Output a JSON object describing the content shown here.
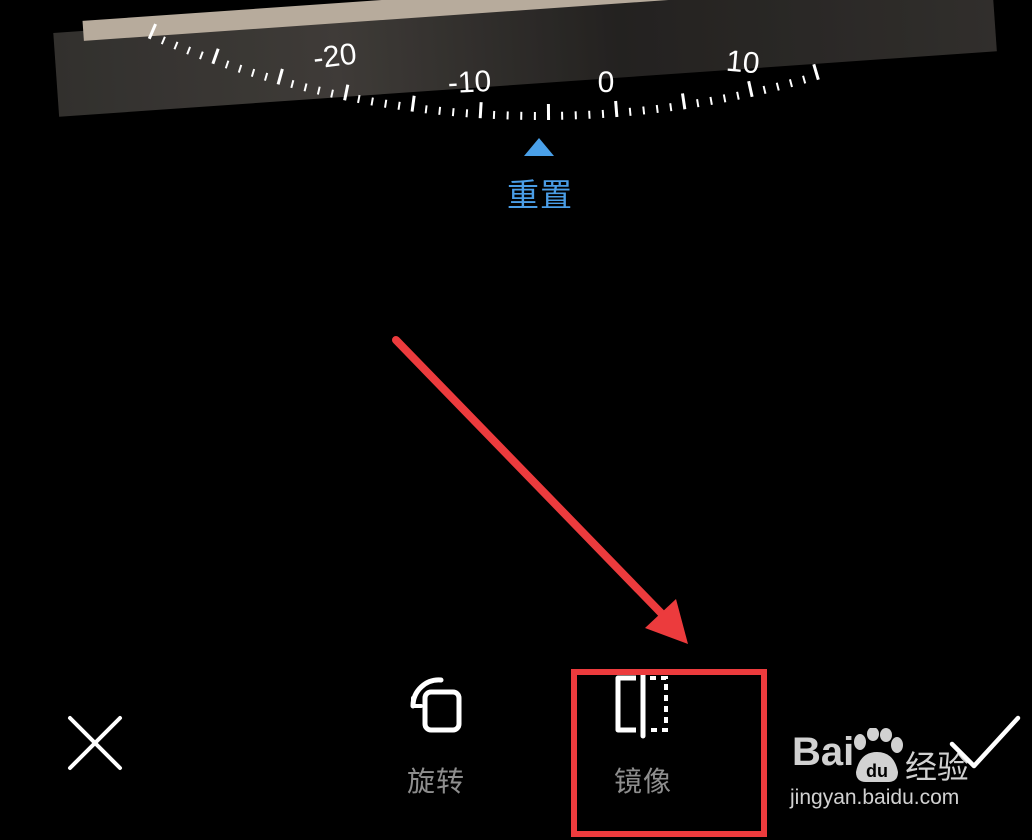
{
  "dial": {
    "tick_labels": [
      "-20",
      "-10",
      "0",
      "10"
    ],
    "value": 0
  },
  "reset": {
    "label": "重置"
  },
  "tools": {
    "rotate_label": "旋转",
    "mirror_label": "镜像"
  },
  "watermark": {
    "logo": "Bai",
    "logo_sub": "du",
    "brand": "经验",
    "url": "jingyan.baidu.com"
  },
  "colors": {
    "accent": "#4a9de6",
    "annotation": "#ec3b3d",
    "tool_label": "#8e8e8e"
  },
  "icons": {
    "cancel": "close-icon",
    "confirm": "check-icon",
    "rotate": "rotate-icon",
    "mirror": "mirror-icon"
  }
}
